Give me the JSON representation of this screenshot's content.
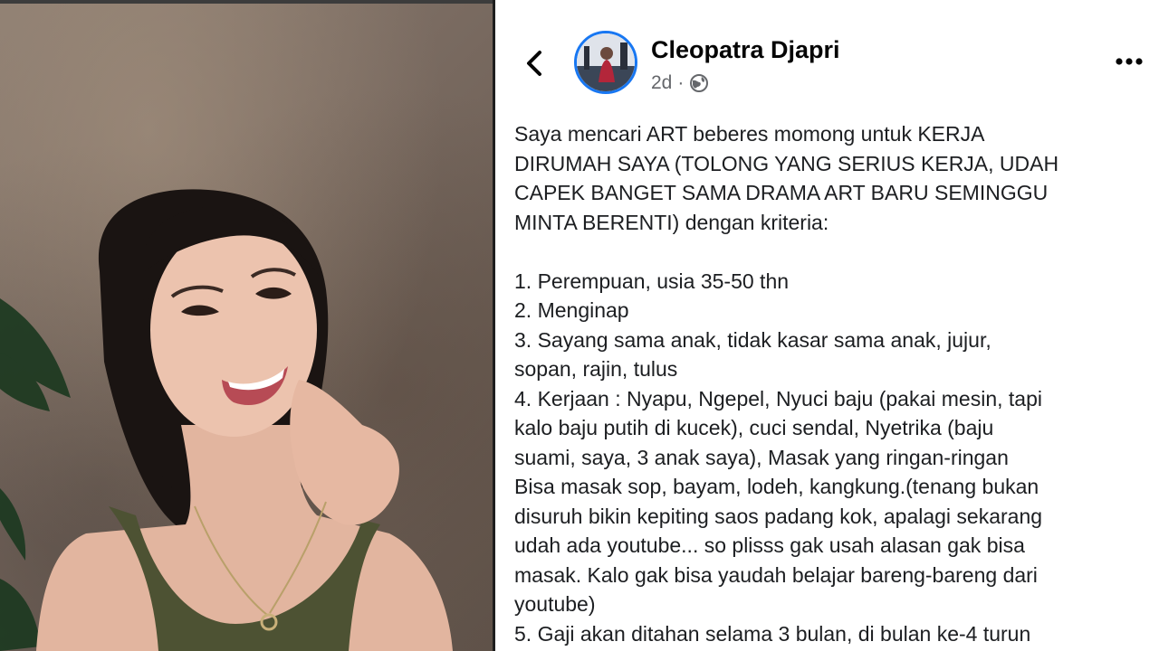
{
  "post": {
    "author": "Cleopatra Djapri",
    "time": "2d",
    "separator": "·",
    "privacy_icon": "globe-icon",
    "intro_lines": [
      "Saya mencari ART beberes momong untuk KERJA",
      "DIRUMAH SAYA (TOLONG YANG SERIUS KERJA, UDAH",
      "CAPEK BANGET SAMA DRAMA ART BARU SEMINGGU",
      "MINTA BERENTI) dengan kriteria:"
    ],
    "list_lines": [
      "1. Perempuan, usia 35-50 thn",
      "2. Menginap",
      "3. Sayang sama anak, tidak kasar sama anak, jujur,",
      "sopan, rajin, tulus",
      "4. Kerjaan : Nyapu, Ngepel, Nyuci baju (pakai mesin, tapi",
      "kalo baju putih di kucek), cuci sendal, Nyetrika (baju",
      "suami, saya, 3 anak saya), Masak yang ringan-ringan",
      "Bisa masak sop, bayam, lodeh, kangkung.(tenang bukan",
      "disuruh bikin kepiting saos padang kok, apalagi sekarang",
      "udah ada youtube... so plisss gak usah alasan gak bisa",
      "masak. Kalo gak bisa yaudah belajar bareng-bareng dari",
      "youtube)",
      "5. Gaji akan ditahan selama 3 bulan, di bulan ke-4 turun"
    ]
  },
  "colors": {
    "accent": "#1877f2",
    "text": "#1c1e21",
    "muted": "#65676b"
  }
}
